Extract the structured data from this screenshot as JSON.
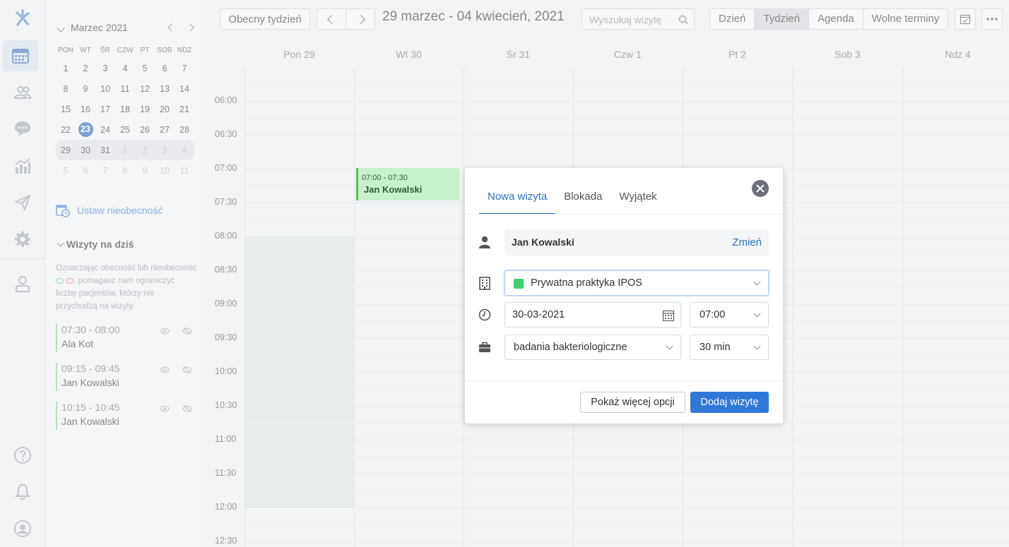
{
  "rail": {
    "items": [
      {
        "name": "logo-icon"
      },
      {
        "name": "calendar-icon"
      },
      {
        "name": "patients-icon"
      },
      {
        "name": "messages-icon"
      },
      {
        "name": "statistics-icon"
      },
      {
        "name": "send-icon"
      },
      {
        "name": "settings-icon"
      },
      {
        "name": "user-admin-icon"
      },
      {
        "name": "help-icon"
      },
      {
        "name": "notifications-icon"
      },
      {
        "name": "profile-icon"
      }
    ],
    "active": "calendar-icon"
  },
  "mini_calendar": {
    "title": "Marzec 2021",
    "weekdays": [
      "PON",
      "WT",
      "ŚR",
      "CZW",
      "PT",
      "SOB",
      "NDZ"
    ],
    "weeks": [
      [
        "1",
        "2",
        "3",
        "4",
        "5",
        "6",
        "7"
      ],
      [
        "8",
        "9",
        "10",
        "11",
        "12",
        "13",
        "14"
      ],
      [
        "15",
        "16",
        "17",
        "18",
        "19",
        "20",
        "21"
      ],
      [
        "22",
        "23",
        "24",
        "25",
        "26",
        "27",
        "28"
      ],
      [
        "29",
        "30",
        "31",
        "1",
        "2",
        "3",
        "4"
      ],
      [
        "5",
        "6",
        "7",
        "8",
        "9",
        "10",
        "11"
      ]
    ],
    "today": "23"
  },
  "absence_link": "Ustaw nieobecność",
  "today_visits": {
    "title": "Wizyty na dziś",
    "note_part1": "Oznaczając obecność lub nieobecność",
    "note_part2": ", pomagasz nam ograniczyć liczbę pacjentów, którzy nie przychodzą na wizyty.",
    "items": [
      {
        "time": "07:30 - 08:00",
        "name": "Ala Kot"
      },
      {
        "time": "09:15 - 09:45",
        "name": "Jan Kowalski"
      },
      {
        "time": "10:15 - 10:45",
        "name": "Jan Kowalski"
      }
    ]
  },
  "toolbar": {
    "current_week": "Obecny tydzień",
    "range": "29 marzec - 04 kwiecień, 2021",
    "search_placeholder": "Wyszukaj wizytę",
    "views": [
      "Dzień",
      "Tydzień",
      "Agenda",
      "Wolne terminy"
    ],
    "active_view": "Tydzień"
  },
  "week": {
    "days": [
      "Pon 29",
      "Wt 30",
      "Śr 31",
      "Czw 1",
      "Pt 2",
      "Sob 3",
      "Ndz 4"
    ],
    "times": [
      "06:00",
      "06:30",
      "07:00",
      "07:30",
      "08:00",
      "08:30",
      "09:00",
      "09:30",
      "10:00",
      "10:30",
      "11:00",
      "11:30",
      "12:00",
      "12:30"
    ],
    "event": {
      "time": "07:00 - 07:30",
      "name": "Jan Kowalski"
    }
  },
  "modal": {
    "tabs": [
      "Nowa wizyta",
      "Blokada",
      "Wyjątek"
    ],
    "active_tab": "Nowa wizyta",
    "patient": "Jan Kowalski",
    "change_label": "Zmień",
    "location": "Prywatna praktyka IPOS",
    "location_color": "#3dd16a",
    "date": "30-03-2021",
    "time": "07:00",
    "service": "badania bakteriologiczne",
    "duration": "30 min",
    "more_options": "Pokaż więcej opcji",
    "submit": "Dodaj wizytę"
  },
  "colors": {
    "accent": "#2f78d8",
    "event_bg": "#c9f0cd",
    "event_border": "#4cbf5c"
  }
}
